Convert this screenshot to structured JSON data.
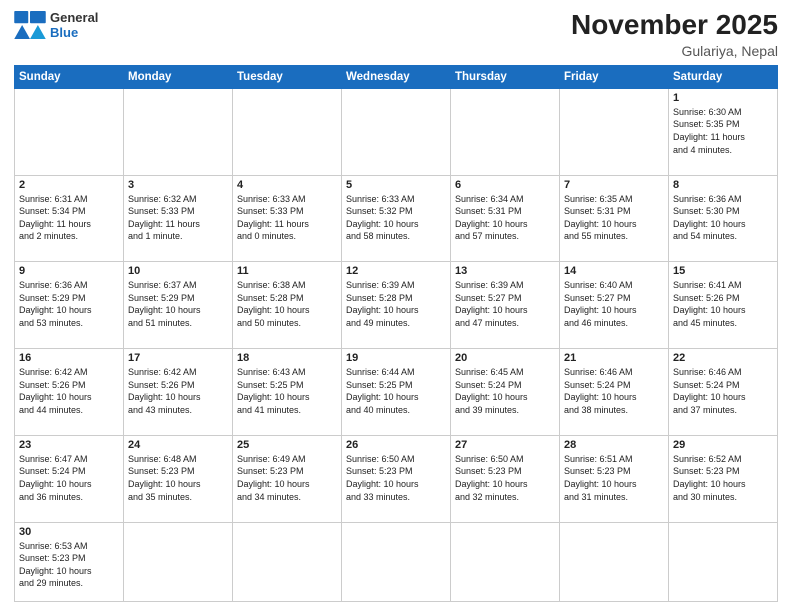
{
  "logo": {
    "line1": "General",
    "line2": "Blue"
  },
  "title": "November 2025",
  "subtitle": "Gulariya, Nepal",
  "weekdays": [
    "Sunday",
    "Monday",
    "Tuesday",
    "Wednesday",
    "Thursday",
    "Friday",
    "Saturday"
  ],
  "days": [
    {
      "num": "",
      "info": ""
    },
    {
      "num": "",
      "info": ""
    },
    {
      "num": "",
      "info": ""
    },
    {
      "num": "",
      "info": ""
    },
    {
      "num": "",
      "info": ""
    },
    {
      "num": "",
      "info": ""
    },
    {
      "num": "1",
      "info": "Sunrise: 6:30 AM\nSunset: 5:35 PM\nDaylight: 11 hours\nand 4 minutes."
    },
    {
      "num": "2",
      "info": "Sunrise: 6:31 AM\nSunset: 5:34 PM\nDaylight: 11 hours\nand 2 minutes."
    },
    {
      "num": "3",
      "info": "Sunrise: 6:32 AM\nSunset: 5:33 PM\nDaylight: 11 hours\nand 1 minute."
    },
    {
      "num": "4",
      "info": "Sunrise: 6:33 AM\nSunset: 5:33 PM\nDaylight: 11 hours\nand 0 minutes."
    },
    {
      "num": "5",
      "info": "Sunrise: 6:33 AM\nSunset: 5:32 PM\nDaylight: 10 hours\nand 58 minutes."
    },
    {
      "num": "6",
      "info": "Sunrise: 6:34 AM\nSunset: 5:31 PM\nDaylight: 10 hours\nand 57 minutes."
    },
    {
      "num": "7",
      "info": "Sunrise: 6:35 AM\nSunset: 5:31 PM\nDaylight: 10 hours\nand 55 minutes."
    },
    {
      "num": "8",
      "info": "Sunrise: 6:36 AM\nSunset: 5:30 PM\nDaylight: 10 hours\nand 54 minutes."
    },
    {
      "num": "9",
      "info": "Sunrise: 6:36 AM\nSunset: 5:29 PM\nDaylight: 10 hours\nand 53 minutes."
    },
    {
      "num": "10",
      "info": "Sunrise: 6:37 AM\nSunset: 5:29 PM\nDaylight: 10 hours\nand 51 minutes."
    },
    {
      "num": "11",
      "info": "Sunrise: 6:38 AM\nSunset: 5:28 PM\nDaylight: 10 hours\nand 50 minutes."
    },
    {
      "num": "12",
      "info": "Sunrise: 6:39 AM\nSunset: 5:28 PM\nDaylight: 10 hours\nand 49 minutes."
    },
    {
      "num": "13",
      "info": "Sunrise: 6:39 AM\nSunset: 5:27 PM\nDaylight: 10 hours\nand 47 minutes."
    },
    {
      "num": "14",
      "info": "Sunrise: 6:40 AM\nSunset: 5:27 PM\nDaylight: 10 hours\nand 46 minutes."
    },
    {
      "num": "15",
      "info": "Sunrise: 6:41 AM\nSunset: 5:26 PM\nDaylight: 10 hours\nand 45 minutes."
    },
    {
      "num": "16",
      "info": "Sunrise: 6:42 AM\nSunset: 5:26 PM\nDaylight: 10 hours\nand 44 minutes."
    },
    {
      "num": "17",
      "info": "Sunrise: 6:42 AM\nSunset: 5:26 PM\nDaylight: 10 hours\nand 43 minutes."
    },
    {
      "num": "18",
      "info": "Sunrise: 6:43 AM\nSunset: 5:25 PM\nDaylight: 10 hours\nand 41 minutes."
    },
    {
      "num": "19",
      "info": "Sunrise: 6:44 AM\nSunset: 5:25 PM\nDaylight: 10 hours\nand 40 minutes."
    },
    {
      "num": "20",
      "info": "Sunrise: 6:45 AM\nSunset: 5:24 PM\nDaylight: 10 hours\nand 39 minutes."
    },
    {
      "num": "21",
      "info": "Sunrise: 6:46 AM\nSunset: 5:24 PM\nDaylight: 10 hours\nand 38 minutes."
    },
    {
      "num": "22",
      "info": "Sunrise: 6:46 AM\nSunset: 5:24 PM\nDaylight: 10 hours\nand 37 minutes."
    },
    {
      "num": "23",
      "info": "Sunrise: 6:47 AM\nSunset: 5:24 PM\nDaylight: 10 hours\nand 36 minutes."
    },
    {
      "num": "24",
      "info": "Sunrise: 6:48 AM\nSunset: 5:23 PM\nDaylight: 10 hours\nand 35 minutes."
    },
    {
      "num": "25",
      "info": "Sunrise: 6:49 AM\nSunset: 5:23 PM\nDaylight: 10 hours\nand 34 minutes."
    },
    {
      "num": "26",
      "info": "Sunrise: 6:50 AM\nSunset: 5:23 PM\nDaylight: 10 hours\nand 33 minutes."
    },
    {
      "num": "27",
      "info": "Sunrise: 6:50 AM\nSunset: 5:23 PM\nDaylight: 10 hours\nand 32 minutes."
    },
    {
      "num": "28",
      "info": "Sunrise: 6:51 AM\nSunset: 5:23 PM\nDaylight: 10 hours\nand 31 minutes."
    },
    {
      "num": "29",
      "info": "Sunrise: 6:52 AM\nSunset: 5:23 PM\nDaylight: 10 hours\nand 30 minutes."
    },
    {
      "num": "30",
      "info": "Sunrise: 6:53 AM\nSunset: 5:23 PM\nDaylight: 10 hours\nand 29 minutes."
    },
    {
      "num": "",
      "info": ""
    },
    {
      "num": "",
      "info": ""
    },
    {
      "num": "",
      "info": ""
    },
    {
      "num": "",
      "info": ""
    },
    {
      "num": "",
      "info": ""
    },
    {
      "num": "",
      "info": ""
    }
  ]
}
